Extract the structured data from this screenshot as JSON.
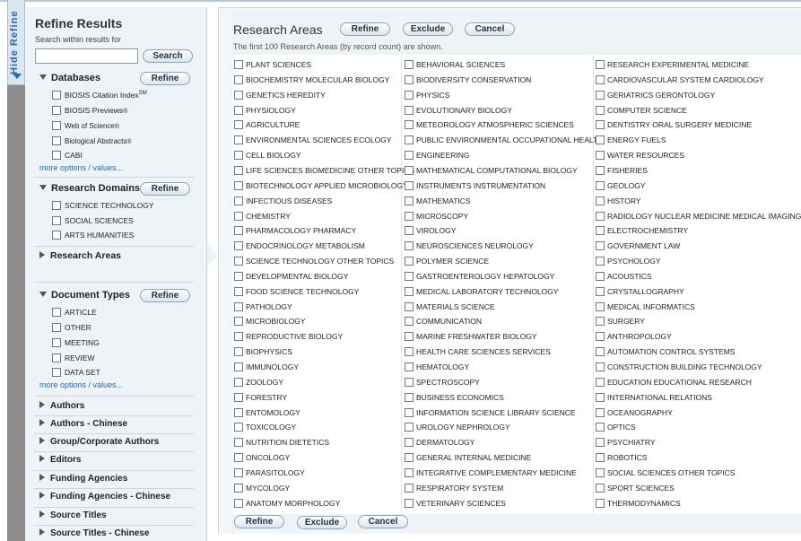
{
  "hide_tab": {
    "label": "Hide Refine"
  },
  "sidebar": {
    "title": "Refine Results",
    "search_label": "Search within results for",
    "search_input": {
      "value": "",
      "placeholder": ""
    },
    "search_button": "Search",
    "databases": {
      "title": "Databases",
      "refine_label": "Refine",
      "items": [
        {
          "label": "BIOSIS Citation Index",
          "sup": "SM"
        },
        {
          "label": "BIOSIS Previews",
          "sup": "®"
        },
        {
          "label": "Web of Science",
          "sup": "®"
        },
        {
          "label": "Biological Abstracts",
          "sup": "®"
        },
        {
          "label": "CABI",
          "sup": ""
        }
      ],
      "more_options": "more options / values..."
    },
    "research_domains": {
      "title": "Research Domains",
      "refine_label": "Refine",
      "items": [
        "SCIENCE TECHNOLOGY",
        "SOCIAL SCIENCES",
        "ARTS HUMANITIES"
      ]
    },
    "research_areas_label": "Research Areas",
    "document_types": {
      "title": "Document Types",
      "refine_label": "Refine",
      "items": [
        "ARTICLE",
        "OTHER",
        "MEETING",
        "REVIEW",
        "DATA SET"
      ],
      "more_options": "more options / values..."
    },
    "collapsed_sections": [
      "Authors",
      "Authors - Chinese",
      "Group/Corporate Authors",
      "Editors",
      "Funding Agencies",
      "Funding Agencies - Chinese",
      "Source Titles",
      "Source Titles - Chinese"
    ]
  },
  "main": {
    "title": "Research Areas",
    "refine_label": "Refine",
    "exclude_label": "Exclude",
    "cancel_label": "Cancel",
    "subtitle": "The first 100 Research Areas (by record count) are shown.",
    "columns": [
      [
        "PLANT SCIENCES",
        "BIOCHEMISTRY MOLECULAR BIOLOGY",
        "GENETICS HEREDITY",
        "PHYSIOLOGY",
        "AGRICULTURE",
        "ENVIRONMENTAL SCIENCES ECOLOGY",
        "CELL BIOLOGY",
        "LIFE SCIENCES BIOMEDICINE OTHER TOPICS",
        "BIOTECHNOLOGY APPLIED MICROBIOLOGY",
        "INFECTIOUS DISEASES",
        "CHEMISTRY",
        "PHARMACOLOGY PHARMACY",
        "ENDOCRINOLOGY METABOLISM",
        "SCIENCE TECHNOLOGY OTHER TOPICS",
        "DEVELOPMENTAL BIOLOGY",
        "FOOD SCIENCE TECHNOLOGY",
        "PATHOLOGY",
        "MICROBIOLOGY",
        "REPRODUCTIVE BIOLOGY",
        "BIOPHYSICS",
        "IMMUNOLOGY",
        "ZOOLOGY",
        "FORESTRY",
        "ENTOMOLOGY",
        "TOXICOLOGY",
        "NUTRITION DIETETICS",
        "ONCOLOGY",
        "PARASITOLOGY",
        "MYCOLOGY",
        "ANATOMY MORPHOLOGY"
      ],
      [
        "BEHAVIORAL SCIENCES",
        "BIODIVERSITY CONSERVATION",
        "PHYSICS",
        "EVOLUTIONARY BIOLOGY",
        "METEOROLOGY ATMOSPHERIC SCIENCES",
        "PUBLIC ENVIRONMENTAL OCCUPATIONAL HEALTH",
        "ENGINEERING",
        "MATHEMATICAL COMPUTATIONAL BIOLOGY",
        "INSTRUMENTS INSTRUMENTATION",
        "MATHEMATICS",
        "MICROSCOPY",
        "VIROLOGY",
        "NEUROSCIENCES NEUROLOGY",
        "POLYMER SCIENCE",
        "GASTROENTEROLOGY HEPATOLOGY",
        "MEDICAL LABORATORY TECHNOLOGY",
        "MATERIALS SCIENCE",
        "COMMUNICATION",
        "MARINE FRESHWATER BIOLOGY",
        "HEALTH CARE SCIENCES SERVICES",
        "HEMATOLOGY",
        "SPECTROSCOPY",
        "BUSINESS ECONOMICS",
        "INFORMATION SCIENCE LIBRARY SCIENCE",
        "UROLOGY NEPHROLOGY",
        "DERMATOLOGY",
        "GENERAL INTERNAL MEDICINE",
        "INTEGRATIVE COMPLEMENTARY MEDICINE",
        "RESPIRATORY SYSTEM",
        "VETERINARY SCIENCES"
      ],
      [
        "RESEARCH EXPERIMENTAL MEDICINE",
        "CARDIOVASCULAR SYSTEM CARDIOLOGY",
        "GERIATRICS GERONTOLOGY",
        "COMPUTER SCIENCE",
        "DENTISTRY ORAL SURGERY MEDICINE",
        "ENERGY FUELS",
        "WATER RESOURCES",
        "FISHERIES",
        "GEOLOGY",
        "HISTORY",
        "RADIOLOGY NUCLEAR MEDICINE MEDICAL IMAGING",
        "ELECTROCHEMISTRY",
        "GOVERNMENT LAW",
        "PSYCHOLOGY",
        "ACOUSTICS",
        "CRYSTALLOGRAPHY",
        "MEDICAL INFORMATICS",
        "SURGERY",
        "ANTHROPOLOGY",
        "AUTOMATION CONTROL SYSTEMS",
        "CONSTRUCTION BUILDING TECHNOLOGY",
        "EDUCATION EDUCATIONAL RESEARCH",
        "INTERNATIONAL RELATIONS",
        "OCEANOGRAPHY",
        "OPTICS",
        "PSYCHIATRY",
        "ROBOTICS",
        "SOCIAL SCIENCES OTHER TOPICS",
        "SPORT SCIENCES",
        "THERMODYNAMICS"
      ]
    ]
  },
  "colors": {
    "accent": "#2a6aa8",
    "sidebar_bg": "#eef3f8",
    "gutter": "#8c8c8c"
  }
}
